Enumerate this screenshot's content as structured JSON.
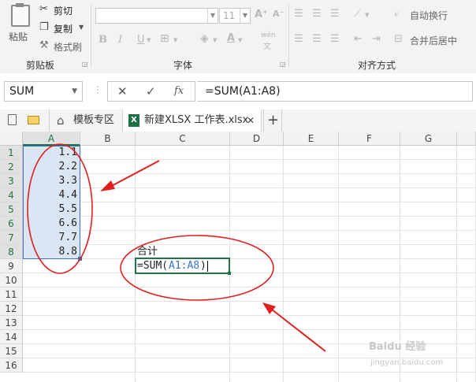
{
  "clipboard": {
    "paste_label": "粘贴",
    "cut_label": "剪切",
    "copy_label": "复制",
    "format_painter_label": "格式刷",
    "group_label": "剪贴板"
  },
  "font": {
    "family_value": "",
    "size_value": "11",
    "group_label": "字体",
    "bold": "B",
    "italic": "I",
    "underline": "U",
    "phonetic": "wén"
  },
  "alignment": {
    "group_label": "对齐方式",
    "wrap_label": "自动换行",
    "merge_label": "合并后居中"
  },
  "formula_bar": {
    "name_box": "SUM",
    "cancel_icon": "✕",
    "enter_icon": "✓",
    "fx": "fx",
    "formula": "=SUM(A1:A8)"
  },
  "tabs": {
    "template_label": "模板专区",
    "file_label": "新建XLSX 工作表.xlsx",
    "close_icon": "✕",
    "add_icon": "+"
  },
  "columns": [
    "A",
    "B",
    "C",
    "D",
    "E",
    "F",
    "G"
  ],
  "rows": [
    "1",
    "2",
    "3",
    "4",
    "5",
    "6",
    "7",
    "8",
    "9",
    "10",
    "11",
    "12",
    "13",
    "14",
    "15",
    "16"
  ],
  "col_a_values": [
    "1.1",
    "2.2",
    "3.3",
    "4.4",
    "5.5",
    "6.6",
    "7.7",
    "8.8"
  ],
  "c8_label": "合计",
  "c9_formula": {
    "prefix": "=SUM(",
    "range": "A1:A8",
    "suffix": ")"
  },
  "watermark": {
    "line1": "Baidu 经验",
    "line2": "jingyan.baidu.com"
  },
  "colors": {
    "selection_fill": "#dbe6f4",
    "selection_border": "#3a73c5",
    "annotation_red": "#e02020",
    "active_green": "#217346"
  }
}
